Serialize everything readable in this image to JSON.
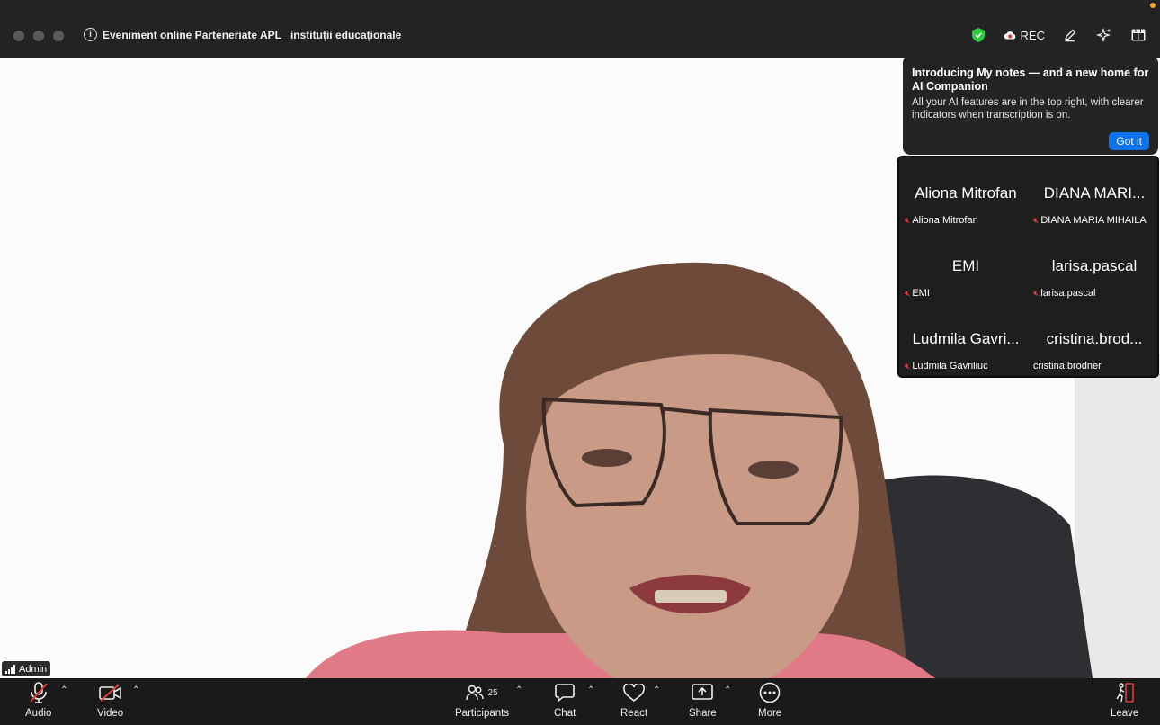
{
  "window": {
    "title": "Eveniment online Parteneriate APL_ instituții educaționale",
    "rec_label": "REC"
  },
  "tooltip": {
    "title": "Introducing My notes — and a new home for AI Companion",
    "body": "All your AI features are in the top right, with clearer indicators when transcription is on.",
    "button": "Got it"
  },
  "gallery": [
    {
      "display": "Aliona Mitrofan",
      "name": "Aliona Mitrofan",
      "muted": true
    },
    {
      "display": "DIANA  MARI...",
      "name": "DIANA  MARIA MIHAILA",
      "muted": true
    },
    {
      "display": "EMI",
      "name": "EMI",
      "muted": true
    },
    {
      "display": "larisa.pascal",
      "name": "larisa.pascal",
      "muted": true
    },
    {
      "display": "Ludmila Gavri...",
      "name": "Ludmila Gavriliuc",
      "muted": true
    },
    {
      "display": "cristina.brod...",
      "name": "cristina.brodner",
      "muted": false
    }
  ],
  "main_video": {
    "speaker_name": "Admin"
  },
  "toolbar": {
    "audio": "Audio",
    "video": "Video",
    "participants": "Participants",
    "participants_count": "25",
    "chat": "Chat",
    "react": "React",
    "share": "Share",
    "more": "More",
    "leave": "Leave"
  },
  "colors": {
    "accent_blue": "#0e72ed",
    "mute_red": "#e23b3b",
    "shield_green": "#2ecc40"
  }
}
